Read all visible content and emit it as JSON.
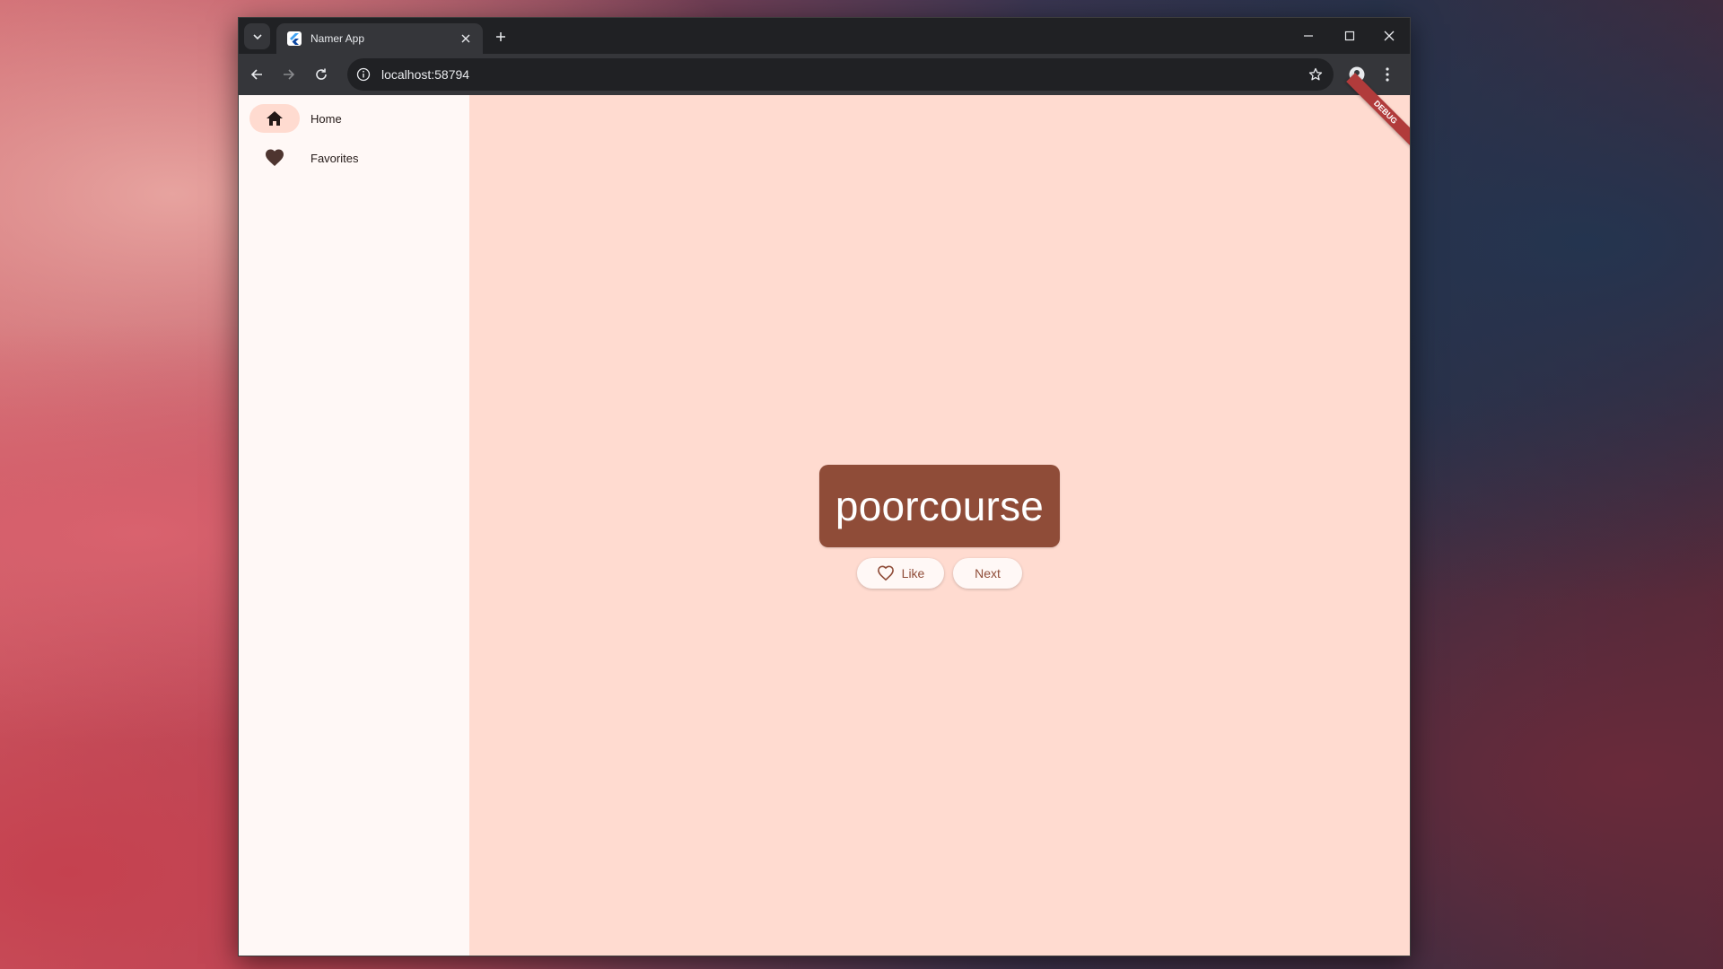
{
  "browser": {
    "tab_title": "Namer App",
    "url": "localhost:58794"
  },
  "nav": {
    "items": [
      {
        "label": "Home",
        "icon": "home-icon",
        "selected": true
      },
      {
        "label": "Favorites",
        "icon": "heart-icon",
        "selected": false
      }
    ]
  },
  "main": {
    "word": "poorcourse",
    "like_label": "Like",
    "next_label": "Next"
  },
  "debug_banner": "DEBUG",
  "colors": {
    "page_background": "#ffdbd0",
    "rail_background": "#fff8f6",
    "card": "#8f4c38",
    "primary_text": "#8f4c38",
    "debug_banner": "#b13b3b"
  }
}
